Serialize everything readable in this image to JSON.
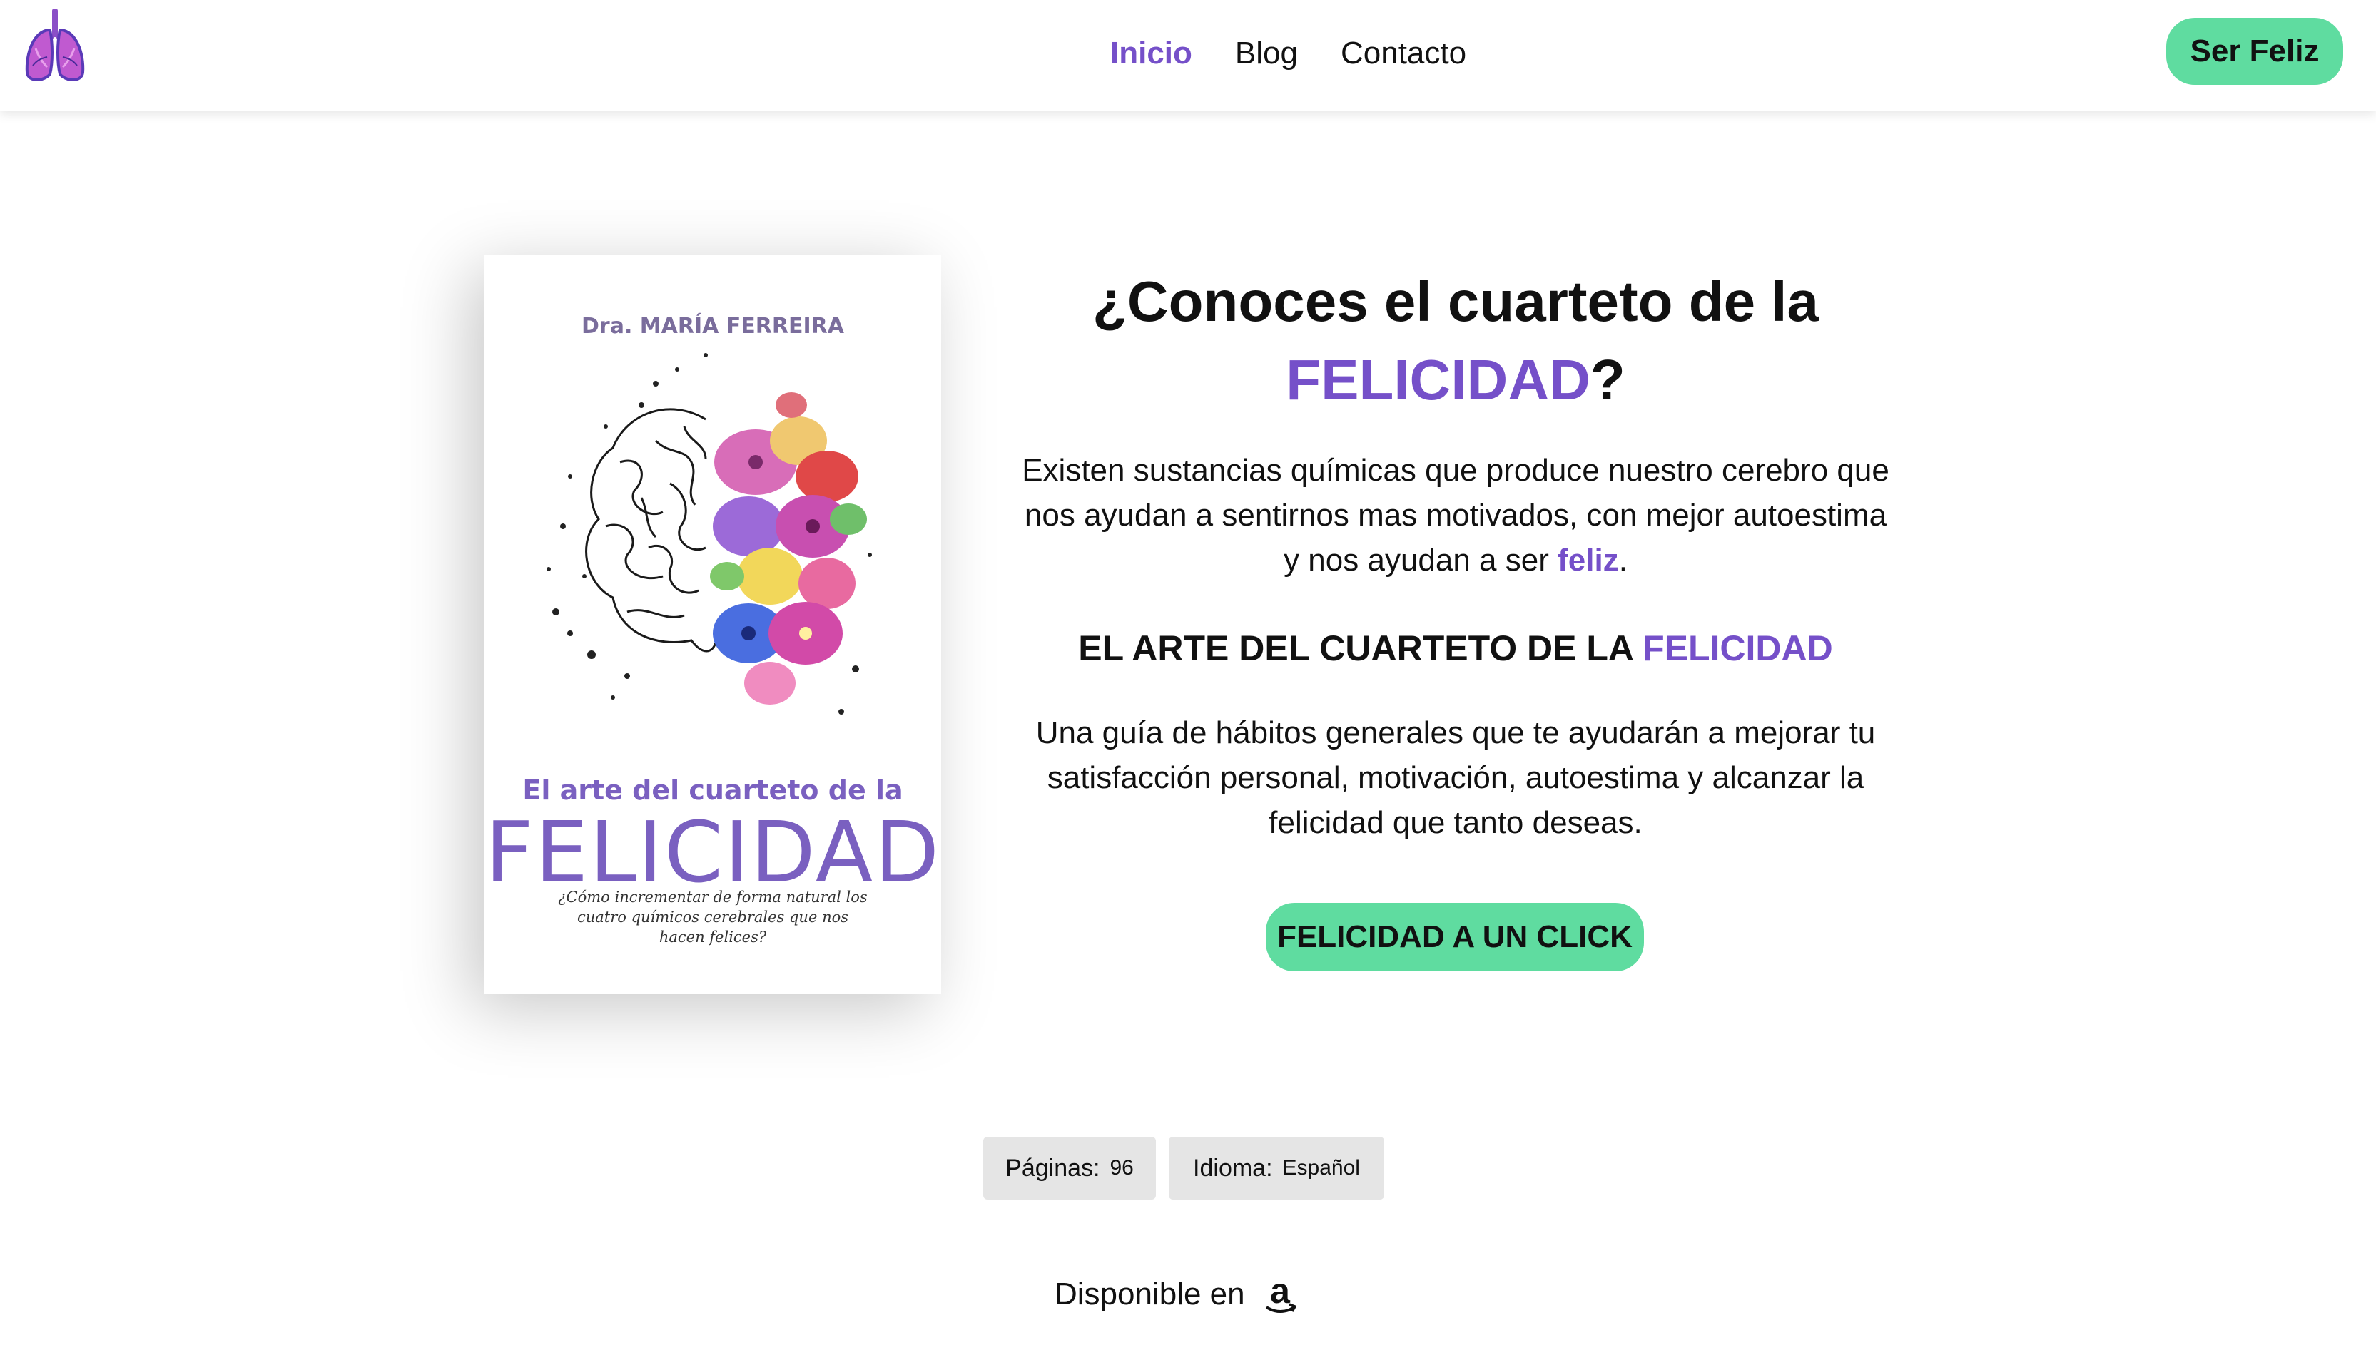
{
  "header": {
    "nav": [
      {
        "label": "Inicio",
        "active": true
      },
      {
        "label": "Blog",
        "active": false
      },
      {
        "label": "Contacto",
        "active": false
      }
    ],
    "cta_label": "Ser Feliz"
  },
  "book": {
    "author": "Dra. MARÍA FERREIRA",
    "subtitle": "El arte del cuarteto de la",
    "title": "FELICIDAD",
    "tagline": "¿Cómo incrementar de forma natural los cuatro químicos cerebrales que nos hacen felices?"
  },
  "hero": {
    "headline_part1": "¿Conoces el cuarteto de la",
    "headline_highlight": "FELICIDAD",
    "headline_end": "?",
    "paragraph1": "Existen sustancias químicas que produce nuestro cerebro que nos ayudan a sentirnos mas motivados, con mejor autoestima y nos ayudan a ser",
    "paragraph1_highlight": "feliz",
    "paragraph1_end": ".",
    "subheading": "EL ARTE DEL CUARTETO DE LA",
    "subheading_highlight": "FELICIDAD",
    "paragraph2": "Una guía de hábitos generales que te ayudarán a mejorar tu satisfacción personal, motivación, autoestima y alcanzar la felicidad que tanto deseas.",
    "cta_label": "FELICIDAD A UN CLICK"
  },
  "details": {
    "pages_label": "Páginas:",
    "pages_value": "96",
    "language_label": "Idioma:",
    "language_value": "Español"
  },
  "availability": {
    "label": "Disponible en",
    "store_icon": "amazon-icon"
  },
  "colors": {
    "accent": "#7550c9",
    "cta": "#5fdca0",
    "badge_bg": "#e5e5e5"
  }
}
